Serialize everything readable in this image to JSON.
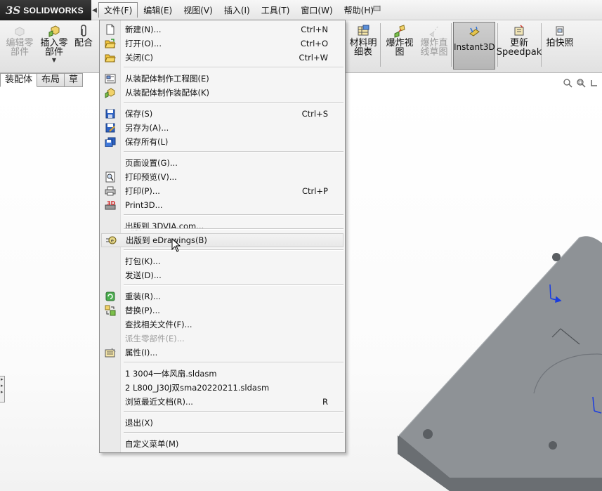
{
  "app": {
    "logo_ds": "3S",
    "logo_name": "SOLIDWORKS"
  },
  "menubar": {
    "items": [
      {
        "label": "文件(F)",
        "active": true
      },
      {
        "label": "编辑(E)"
      },
      {
        "label": "视图(V)"
      },
      {
        "label": "插入(I)"
      },
      {
        "label": "工具(T)"
      },
      {
        "label": "窗口(W)"
      },
      {
        "label": "帮助(H)"
      }
    ]
  },
  "ribbon": {
    "edit_part": "编辑零\n部件",
    "insert_part": "插入零\n部件",
    "mate": "配合",
    "bom": "材料明\n细表",
    "exploded_view": "爆炸视\n图",
    "explode_sketch": "爆炸直\n线草图",
    "instant3d": "Instant3D",
    "update_speedpak": "更新\nSpeedpak",
    "snapshot": "拍快照"
  },
  "tabs": [
    "装配体",
    "布局",
    "草"
  ],
  "file_menu": {
    "items": [
      {
        "label": "新建(N)...",
        "shortcut": "Ctrl+N",
        "icon": "new-document-icon"
      },
      {
        "label": "打开(O)...",
        "shortcut": "Ctrl+O",
        "icon": "open-folder-icon"
      },
      {
        "label": "关闭(C)",
        "shortcut": "Ctrl+W",
        "icon": "close-folder-icon"
      },
      {
        "label": "从装配体制作工程图(E)",
        "shortcut": "",
        "icon": "drawing-from-assembly-icon"
      },
      {
        "label": "从装配体制作装配体(K)",
        "shortcut": "",
        "icon": "assembly-from-assembly-icon"
      },
      {
        "label": "保存(S)",
        "shortcut": "Ctrl+S",
        "icon": "save-icon"
      },
      {
        "label": "另存为(A)...",
        "shortcut": "",
        "icon": "save-as-icon"
      },
      {
        "label": "保存所有(L)",
        "shortcut": "",
        "icon": "save-all-icon"
      },
      {
        "label": "页面设置(G)...",
        "shortcut": "",
        "icon": ""
      },
      {
        "label": "打印预览(V)...",
        "shortcut": "",
        "icon": "print-preview-icon"
      },
      {
        "label": "打印(P)...",
        "shortcut": "Ctrl+P",
        "icon": "print-icon"
      },
      {
        "label": "Print3D...",
        "shortcut": "",
        "icon": "print3d-icon"
      },
      {
        "label": "出版到 3DVIA.com...",
        "shortcut": "",
        "icon": ""
      },
      {
        "label": "出版到 eDrawings(B)",
        "shortcut": "",
        "icon": "edrawings-icon"
      },
      {
        "label": "打包(K)...",
        "shortcut": "",
        "icon": ""
      },
      {
        "label": "发送(D)...",
        "shortcut": "",
        "icon": ""
      },
      {
        "label": "重装(R)...",
        "shortcut": "",
        "icon": "reload-icon"
      },
      {
        "label": "替换(P)...",
        "shortcut": "",
        "icon": "replace-icon"
      },
      {
        "label": "查找相关文件(F)...",
        "shortcut": "",
        "icon": ""
      },
      {
        "label": "派生零部件(E)...",
        "shortcut": "",
        "icon": "",
        "disabled": true
      },
      {
        "label": "属性(I)...",
        "shortcut": "",
        "icon": "properties-icon"
      },
      {
        "label": "1 3004一体风扇.sldasm",
        "shortcut": "",
        "icon": ""
      },
      {
        "label": "2 L800_J30J双sma20220211.sldasm",
        "shortcut": "",
        "icon": ""
      },
      {
        "label": "浏览最近文档(R)...",
        "shortcut": "R",
        "icon": ""
      },
      {
        "label": "退出(X)",
        "shortcut": "",
        "icon": ""
      },
      {
        "label": "自定义菜单(M)",
        "shortcut": "",
        "icon": ""
      }
    ]
  }
}
